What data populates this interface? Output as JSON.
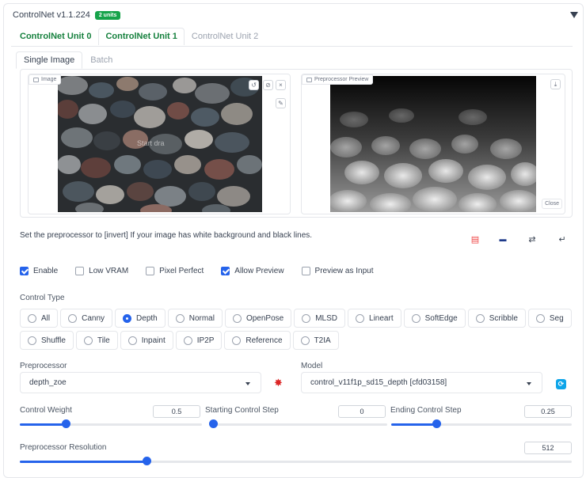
{
  "header": {
    "title": "ControlNet v1.1.224",
    "badge": "2 units"
  },
  "unit_tabs": [
    "ControlNet Unit 0",
    "ControlNet Unit 1",
    "ControlNet Unit 2"
  ],
  "sub_tabs": [
    "Single Image",
    "Batch"
  ],
  "image_panel": {
    "label": "Image",
    "overlay": "Start dra"
  },
  "preview_panel": {
    "label": "Preprocessor Preview",
    "close": "Close"
  },
  "hint": "Set the preprocessor to [invert] If your image has white background and black lines.",
  "checkboxes": [
    {
      "label": "Enable",
      "checked": true
    },
    {
      "label": "Low VRAM",
      "checked": false
    },
    {
      "label": "Pixel Perfect",
      "checked": false
    },
    {
      "label": "Allow Preview",
      "checked": true
    },
    {
      "label": "Preview as Input",
      "checked": false
    }
  ],
  "control_type": {
    "label": "Control Type",
    "options_row1": [
      "All",
      "Canny",
      "Depth",
      "Normal",
      "OpenPose",
      "MLSD",
      "Lineart",
      "SoftEdge",
      "Scribble",
      "Seg"
    ],
    "options_row2": [
      "Shuffle",
      "Tile",
      "Inpaint",
      "IP2P",
      "Reference",
      "T2IA"
    ],
    "selected": "Depth"
  },
  "preprocessor": {
    "label": "Preprocessor",
    "value": "depth_zoe"
  },
  "model": {
    "label": "Model",
    "value": "control_v11f1p_sd15_depth [cfd03158]"
  },
  "sliders": {
    "control_weight": {
      "label": "Control Weight",
      "value": "0.5",
      "fraction": 0.25
    },
    "start_step": {
      "label": "Starting Control Step",
      "value": "0",
      "fraction": 0.0
    },
    "end_step": {
      "label": "Ending Control Step",
      "value": "0.25",
      "fraction": 0.25
    },
    "resolution": {
      "label": "Preprocessor Resolution",
      "value": "512",
      "fraction": 0.23
    }
  },
  "colors": {
    "accent": "#2563eb",
    "green": "#16a34a"
  }
}
